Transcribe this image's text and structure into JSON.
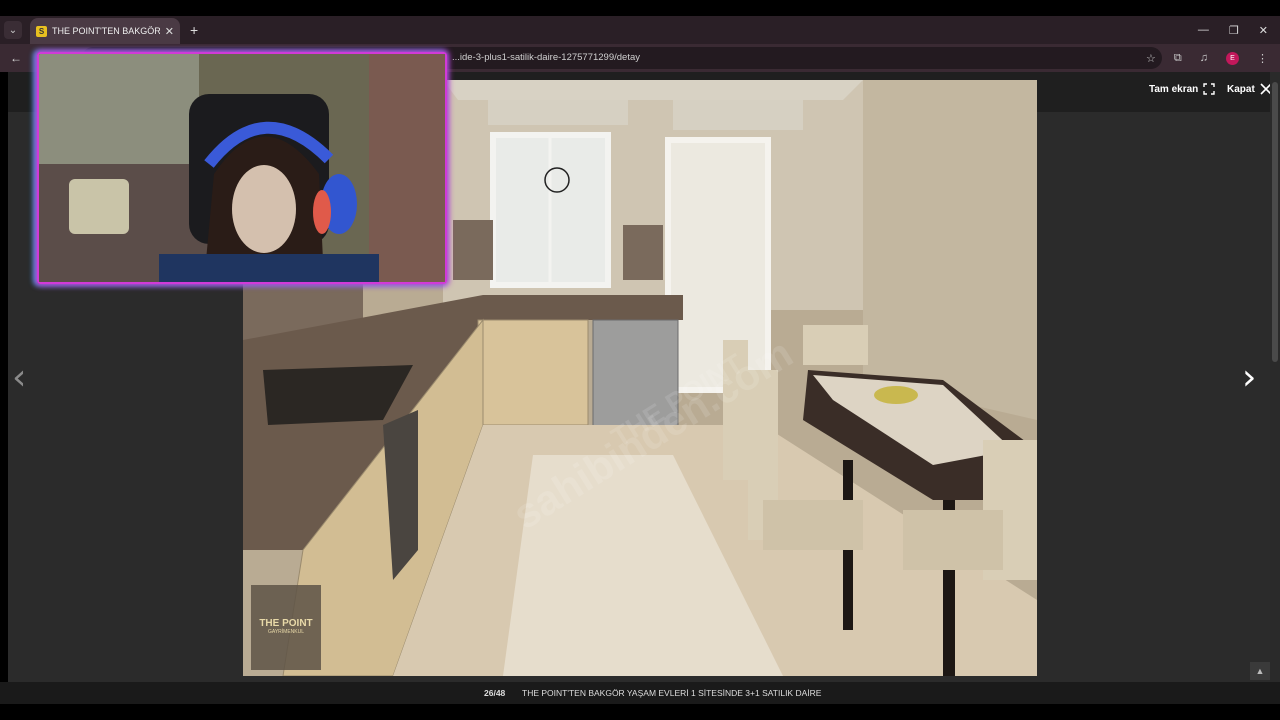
{
  "browser": {
    "tab_title": "THE POINT'TEN BAKGÖR YAŞAM",
    "favicon_letter": "S",
    "url": "...ide-3-plus1-satilik-daire-1275771299/detay"
  },
  "viewer": {
    "fullscreen_label": "Tam ekran",
    "close_label": "Kapat",
    "counter": "26/48",
    "caption": "THE POINT'TEN BAKGÖR YAŞAM EVLERİ 1 SİTESİNDE 3+1 SATILIK DAİRE"
  },
  "photo": {
    "watermark": "sahibinden.com",
    "watermark_sub": "THE POINT",
    "logo_title": "THE POINT",
    "logo_subtitle": "GAYRİMENKUL"
  },
  "icons": {
    "tab_list": "chevron-down-icon",
    "close_tab": "close-icon",
    "new_tab": "plus-icon",
    "back": "arrow-left-icon",
    "bookmark": "star-icon",
    "extensions": "puzzle-icon",
    "media": "media-icon",
    "menu": "kebab-menu-icon"
  },
  "colors": {
    "tab_bar": "#2a1f26",
    "webcam_border_pink": "#d13ad8",
    "webcam_border_cyan": "#1ec8ff",
    "viewer_bg": "#2b2b2b"
  }
}
